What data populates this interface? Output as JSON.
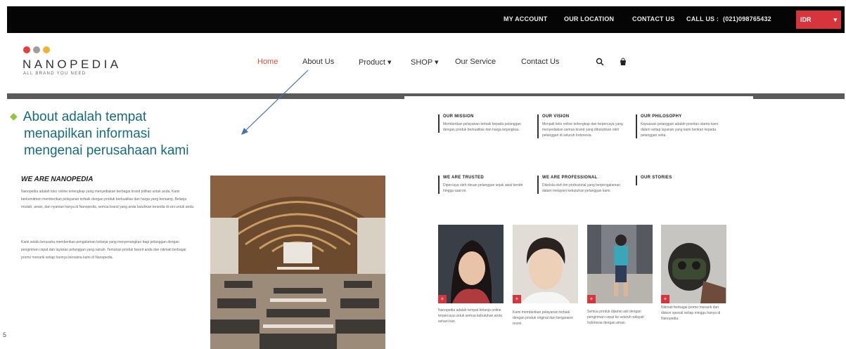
{
  "topbar": {
    "my_account": "MY ACCOUNT",
    "our_location": "OUR LOCATION",
    "contact_us": "CONTACT US",
    "call_us": "CALL US :",
    "phone": "(021)098765432",
    "currency": "IDR",
    "currency_caret": "▾"
  },
  "logo": {
    "name": "NANOPEDIA",
    "tagline": "ALL BRAND YOU NEED",
    "dot_colors": [
      "#e5403a",
      "#9e9e9e",
      "#f2b233"
    ]
  },
  "nav": {
    "home": "Home",
    "about": "About Us",
    "product": "Product",
    "shop": "SHOP",
    "service": "Our Service",
    "contact": "Contact Us",
    "caret": "▾"
  },
  "icons": {
    "search": "search-icon",
    "cart": "cart-icon",
    "bullet": "diamond-bullet-icon"
  },
  "callout": {
    "line1": "About adalah tempat",
    "line2": "menapilkan informasi",
    "line3": "mengenai perusahaan kami"
  },
  "about": {
    "title": "WE ARE NANOPEDIA",
    "para1": "Nanopedia adalah toko online terlengkap yang menyediakan berbagai brand pilihan untuk anda. Kami berkomitmen memberikan pelayanan terbaik dengan produk berkualitas dan harga yang bersaing. Belanja mudah, aman, dan nyaman hanya di Nanopedia, semua brand yang anda butuhkan tersedia di sini untuk anda.",
    "para2": "Kami selalu berusaha memberikan pengalaman belanja yang menyenangkan bagi pelanggan dengan pengiriman cepat dan layanan pelanggan yang ramah. Temukan produk favorit anda dan nikmati berbagai promo menarik setiap harinya bersama kami di Nanopedia."
  },
  "features": [
    {
      "title": "OUR MISSION",
      "text": "Memberikan pelayanan terbaik kepada pelanggan dengan produk berkualitas dan harga terjangkau."
    },
    {
      "title": "OUR VISION",
      "text": "Menjadi toko online terlengkap dan terpercaya yang menyediakan semua brand yang dibutuhkan oleh pelanggan di seluruh Indonesia."
    },
    {
      "title": "OUR PHILOSOPHY",
      "text": "Kepuasan pelanggan adalah prioritas utama kami dalam setiap layanan yang kami berikan kepada pelanggan setia."
    },
    {
      "title": "WE ARE TRUSTED",
      "text": "Dipercaya oleh ribuan pelanggan sejak awal berdiri hingga saat ini."
    },
    {
      "title": "WE ARE PROFESSIONAL",
      "text": "Dikelola oleh tim profesional yang berpengalaman dalam melayani kebutuhan pelanggan kami."
    },
    {
      "title": "OUR STORIES",
      "text": ""
    }
  ],
  "team": [
    {
      "caption": "Nanopedia adalah tempat belanja online terpercaya untuk semua kebutuhan anda sehari-hari."
    },
    {
      "caption": "Kami memberikan pelayanan terbaik dengan produk original dan bergaransi resmi."
    },
    {
      "caption": "Semua produk dijamin asli dengan pengiriman cepat ke seluruh wilayah Indonesia dengan aman."
    },
    {
      "caption": "Nikmati berbagai promo menarik dan diskon spesial setiap minggu hanya di Nanopedia."
    }
  ],
  "slide_number": "5"
}
